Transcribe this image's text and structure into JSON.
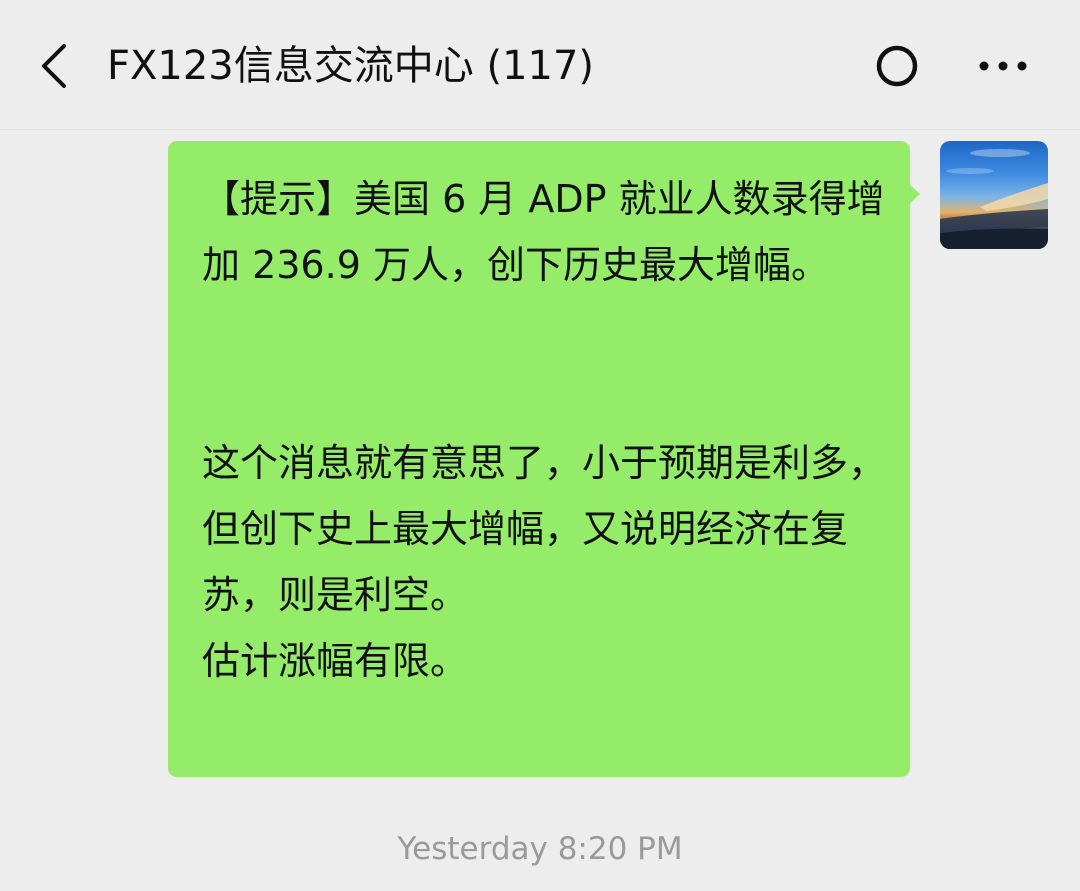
{
  "header": {
    "title": "FX123信息交流中心 (117)",
    "back_icon": "chevron-left-icon",
    "refresh_icon": "circle-icon",
    "more_icon": "more-horizontal-icon"
  },
  "message": {
    "text": "【提示】美国 6 月 ADP 就业人数录得增加 236.9 万人，创下历史最大增幅。\n\n\n这个消息就有意思了，小于预期是利多，但创下史上最大增幅，又说明经济在复苏，则是利空。\n估计涨幅有限。",
    "bubble_color": "#95ec69"
  },
  "timestamp": "Yesterday 8:20 PM",
  "colors": {
    "background": "#ededed",
    "text": "#111111",
    "timestamp": "#9a9a9a"
  }
}
